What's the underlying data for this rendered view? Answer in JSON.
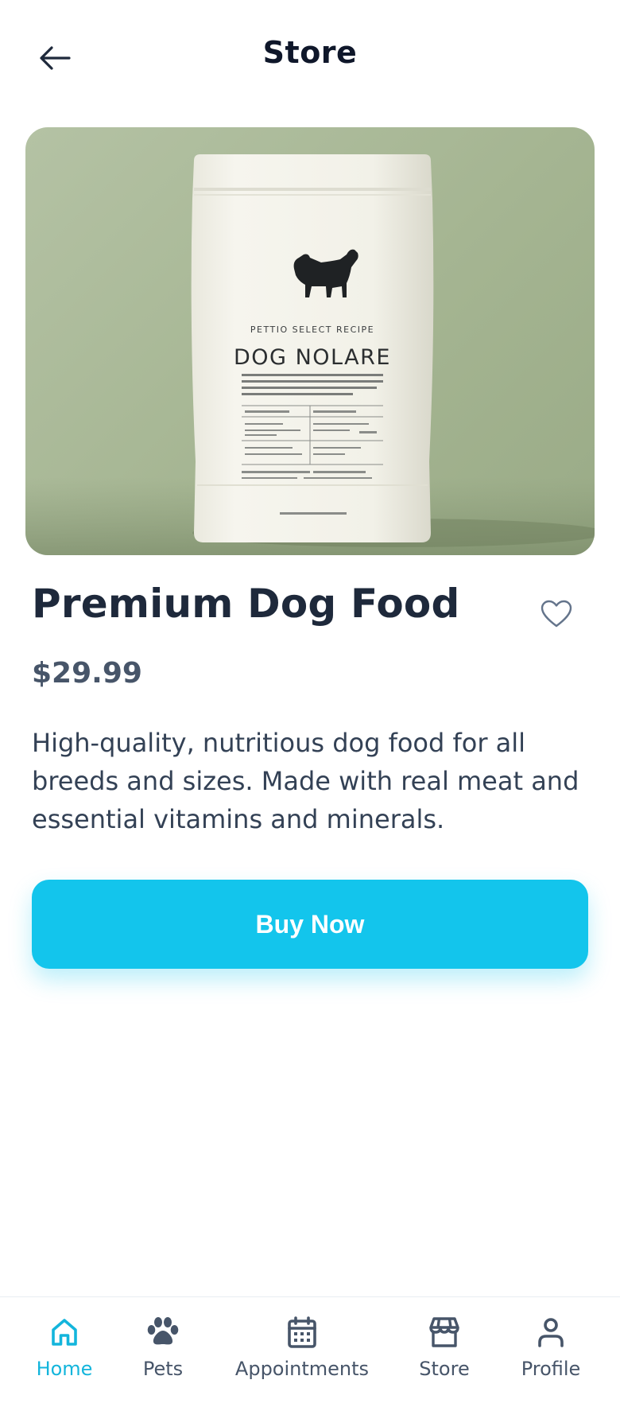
{
  "header": {
    "title": "Store",
    "back_icon": "arrow-left-icon"
  },
  "product": {
    "image_alt": "Premium dog food bag",
    "package_brand_line": "PETTIO SELECT RECIPE",
    "package_name": "DOG NOLARE",
    "title": "Premium Dog Food",
    "price": "$29.99",
    "description": "High-quality, nutritious dog food for all breeds and sizes. Made with real meat and essential vitamins and minerals.",
    "favorite_icon": "heart-icon",
    "buy_label": "Buy Now"
  },
  "nav": {
    "items": [
      {
        "label": "Home",
        "icon": "home-icon",
        "active": true
      },
      {
        "label": "Pets",
        "icon": "paw-icon",
        "active": false
      },
      {
        "label": "Appointments",
        "icon": "calendar-icon",
        "active": false
      },
      {
        "label": "Store",
        "icon": "store-icon",
        "active": false
      },
      {
        "label": "Profile",
        "icon": "user-icon",
        "active": false
      }
    ]
  },
  "colors": {
    "accent": "#13c5ec",
    "active_nav": "#13b5dc",
    "text_dark": "#1e293b",
    "text_muted": "#475569",
    "image_bg": "#a8b795"
  }
}
